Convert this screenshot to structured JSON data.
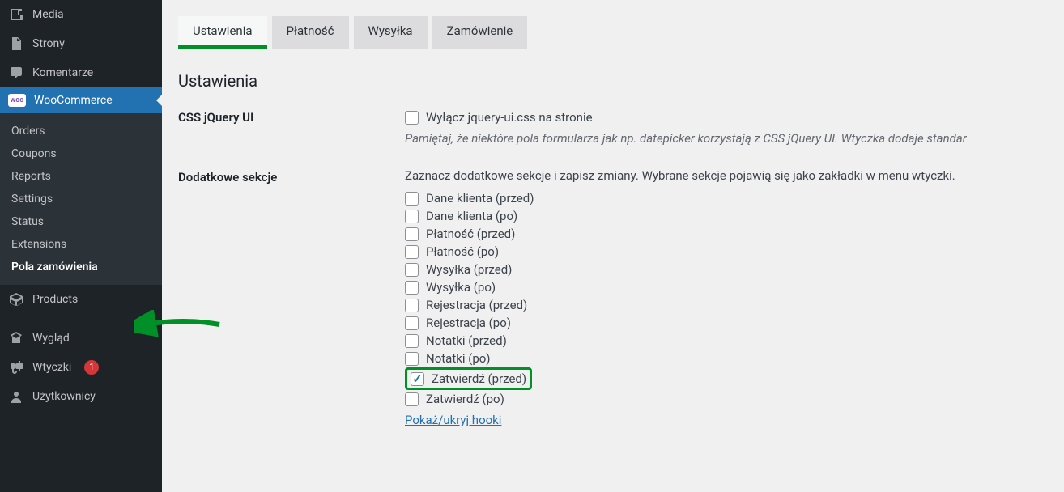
{
  "sidebar": {
    "items": [
      {
        "label": "Media",
        "icon": "media-icon"
      },
      {
        "label": "Strony",
        "icon": "pages-icon"
      },
      {
        "label": "Komentarze",
        "icon": "comments-icon"
      },
      {
        "label": "WooCommerce",
        "icon": "woocommerce-icon",
        "active": true
      },
      {
        "label": "Products",
        "icon": "products-icon"
      },
      {
        "label": "Wygląd",
        "icon": "appearance-icon"
      },
      {
        "label": "Wtyczki",
        "icon": "plugins-icon",
        "badge": "1"
      },
      {
        "label": "Użytkownicy",
        "icon": "users-icon"
      }
    ],
    "sub": [
      {
        "label": "Orders"
      },
      {
        "label": "Coupons"
      },
      {
        "label": "Reports"
      },
      {
        "label": "Settings"
      },
      {
        "label": "Status"
      },
      {
        "label": "Extensions"
      },
      {
        "label": "Pola zamówienia",
        "current": true
      }
    ]
  },
  "tabs": [
    {
      "label": "Ustawienia",
      "active": true
    },
    {
      "label": "Płatność"
    },
    {
      "label": "Wysyłka"
    },
    {
      "label": "Zamówienie"
    }
  ],
  "section_title": "Ustawienia",
  "css_row": {
    "label": "CSS jQuery UI",
    "checkbox_label": "Wyłącz jquery-ui.css na stronie",
    "help": "Pamiętaj, że niektóre pola formularza jak np. datepicker korzystają z CSS jQuery UI. Wtyczka dodaje standar"
  },
  "sections_row": {
    "label": "Dodatkowe sekcje",
    "intro": "Zaznacz dodatkowe sekcje i zapisz zmiany. Wybrane sekcje pojawią się jako zakładki w menu wtyczki.",
    "checkboxes": [
      {
        "label": "Dane klienta (przed)",
        "checked": false
      },
      {
        "label": "Dane klienta (po)",
        "checked": false
      },
      {
        "label": "Płatność (przed)",
        "checked": false
      },
      {
        "label": "Płatność (po)",
        "checked": false
      },
      {
        "label": "Wysyłka (przed)",
        "checked": false
      },
      {
        "label": "Wysyłka (po)",
        "checked": false
      },
      {
        "label": "Rejestracja (przed)",
        "checked": false
      },
      {
        "label": "Rejestracja (po)",
        "checked": false
      },
      {
        "label": "Notatki (przed)",
        "checked": false
      },
      {
        "label": "Notatki (po)",
        "checked": false
      },
      {
        "label": "Zatwierdź (przed)",
        "checked": true,
        "highlight": true
      },
      {
        "label": "Zatwierdź (po)",
        "checked": false
      }
    ],
    "link": "Pokaż/ukryj hooki"
  }
}
